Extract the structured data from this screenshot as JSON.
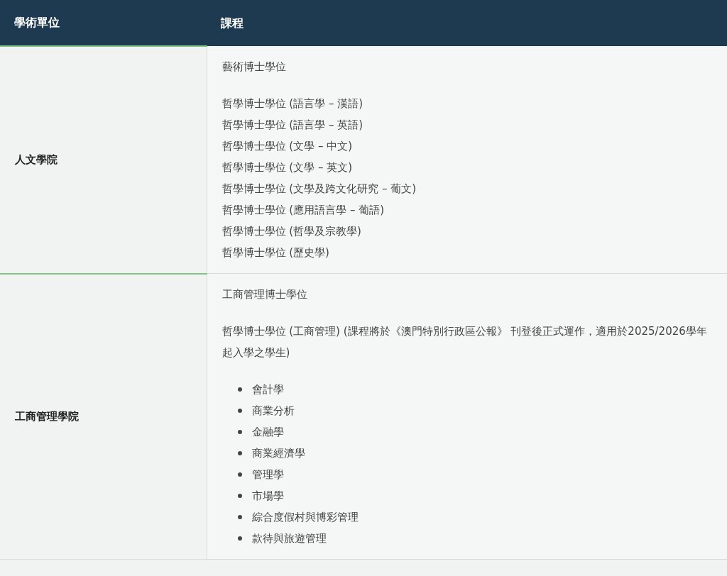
{
  "table": {
    "columns": [
      "學術單位",
      "課程"
    ],
    "rows": [
      {
        "unit": "人文學院",
        "blocks": [
          {
            "kind": "paragraph",
            "text": "藝術博士學位"
          },
          {
            "kind": "lines",
            "items": [
              "哲學博士學位 (語言學 – 漢語)",
              "哲學博士學位 (語言學 – 英語)",
              "哲學博士學位 (文學 – 中文)",
              "哲學博士學位 (文學 – 英文)",
              "哲學博士學位 (文學及跨文化研究 – 葡文)",
              "哲學博士學位 (應用語言學 – 葡語)",
              "哲學博士學位 (哲學及宗教學)",
              "哲學博士學位 (歷史學)"
            ]
          }
        ]
      },
      {
        "unit": "工商管理學院",
        "blocks": [
          {
            "kind": "paragraph",
            "text": "工商管理博士學位"
          },
          {
            "kind": "paragraph",
            "text": "哲學博士學位 (工商管理) (課程將於《澳門特別行政區公報》 刊登後正式運作，適用於2025/2026學年起入學之學生)"
          },
          {
            "kind": "bullets",
            "items": [
              "會計學",
              "商業分析",
              "金融學",
              "商業經濟學",
              "管理學",
              "市場學",
              "綜合度假村與博彩管理",
              "款待與旅遊管理"
            ]
          }
        ]
      }
    ]
  }
}
